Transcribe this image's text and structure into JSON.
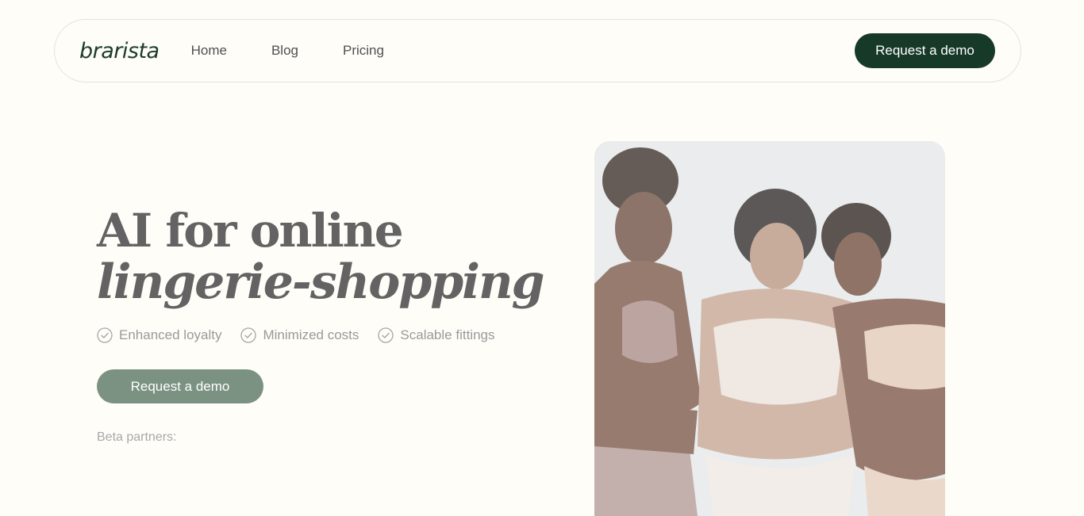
{
  "nav": {
    "logo": "brarista",
    "links": [
      "Home",
      "Blog",
      "Pricing"
    ],
    "cta_label": "Request a demo"
  },
  "hero": {
    "title_line1": "AI for online",
    "title_line2": "lingerie-shopping",
    "features": [
      "Enhanced loyalty",
      "Minimized costs",
      "Scalable fittings"
    ],
    "cta_label": "Request a demo",
    "beta_label": "Beta partners:"
  },
  "colors": {
    "background": "#fffdf8",
    "brand_dark": "#173a28",
    "brand_muted": "#7b9282"
  },
  "icons": {
    "feature_icon": "check-circle-icon"
  }
}
